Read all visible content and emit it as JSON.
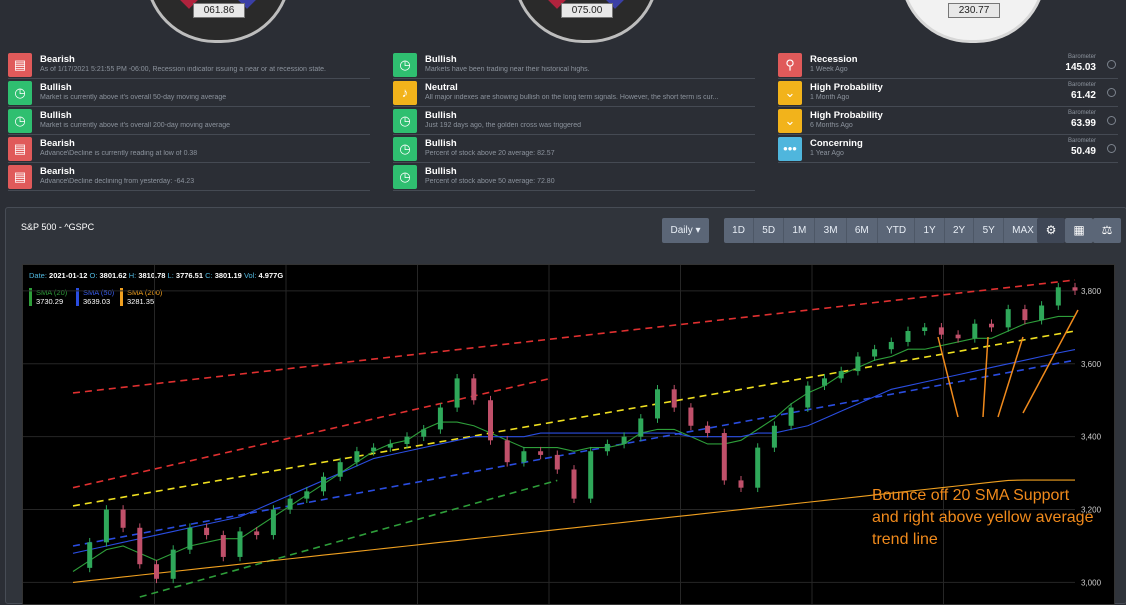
{
  "gauges": [
    {
      "value": "061.86"
    },
    {
      "value": "075.00"
    },
    {
      "value": "230.77"
    }
  ],
  "left_signals": [
    {
      "title": "Bearish",
      "sub": "As of 1/17/2021 5:21:55 PM -06:00, Recession indicator issuing a near or at recession state.",
      "color": "#e05a5a",
      "icon": "message-icon",
      "glyph": "▤"
    },
    {
      "title": "Bullish",
      "sub": "Market is currently above it's overall 50-day moving average",
      "color": "#2fbf70",
      "icon": "gauge-icon",
      "glyph": "◷"
    },
    {
      "title": "Bullish",
      "sub": "Market is currently above it's overall 200-day moving average",
      "color": "#2fbf70",
      "icon": "gauge-icon",
      "glyph": "◷"
    },
    {
      "title": "Bearish",
      "sub": "Advance\\Decline is currently reading at low of 0.38",
      "color": "#e05a5a",
      "icon": "message-icon",
      "glyph": "▤"
    },
    {
      "title": "Bearish",
      "sub": "Advance\\Decline declining from yesterday: -64.23",
      "color": "#e05a5a",
      "icon": "message-icon",
      "glyph": "▤"
    }
  ],
  "mid_signals": [
    {
      "title": "Bullish",
      "sub": "Markets have been trading near their historical highs.",
      "color": "#2fbf70",
      "icon": "gauge-icon",
      "glyph": "◷"
    },
    {
      "title": "Neutral",
      "sub": "All major indexes are showing bullish on the long term signals. However, the short term is cur...",
      "color": "#f2b31b",
      "icon": "bell-icon",
      "glyph": "♪"
    },
    {
      "title": "Bullish",
      "sub": "Just 192 days ago, the golden cross was triggered",
      "color": "#2fbf70",
      "icon": "gauge-icon",
      "glyph": "◷"
    },
    {
      "title": "Bullish",
      "sub": "Percent of stock above 20 average: 82.57",
      "color": "#2fbf70",
      "icon": "gauge-icon",
      "glyph": "◷"
    },
    {
      "title": "Bullish",
      "sub": "Percent of stock above 50 average: 72.80",
      "color": "#2fbf70",
      "icon": "gauge-icon",
      "glyph": "◷"
    }
  ],
  "right_signals": [
    {
      "title": "Recession",
      "sub": "1 Week Ago",
      "label": "Barometer",
      "value": "145.03",
      "color": "#e05a5a",
      "icon": "pin-icon",
      "glyph": "⚲"
    },
    {
      "title": "High Probability",
      "sub": "1 Month Ago",
      "label": "Barometer",
      "value": "61.42",
      "color": "#f2b31b",
      "icon": "chevron-down-icon",
      "glyph": "⌄"
    },
    {
      "title": "High Probability",
      "sub": "6 Months Ago",
      "label": "Barometer",
      "value": "63.99",
      "color": "#f2b31b",
      "icon": "chevron-down-icon",
      "glyph": "⌄"
    },
    {
      "title": "Concerning",
      "sub": "1 Year Ago",
      "label": "Barometer",
      "value": "50.49",
      "color": "#4fb6dd",
      "icon": "ellipsis-icon",
      "glyph": "•••"
    }
  ],
  "chart_card": {
    "title": "S&P 500 - ^GSPC",
    "interval": "Daily ▾",
    "periods": [
      "1D",
      "5D",
      "1M",
      "3M",
      "6M",
      "YTD",
      "1Y",
      "2Y",
      "5Y",
      "MAX"
    ]
  },
  "ohlc": {
    "date_label": "Date:",
    "date": "2021-01-12",
    "o_label": "O:",
    "o": "3801.62",
    "h_label": "H:",
    "h": "3810.78",
    "l_label": "L:",
    "l": "3776.51",
    "c_label": "C:",
    "c": "3801.19",
    "vol_label": "Vol:",
    "vol": "4.977G"
  },
  "legend": [
    {
      "name": "SMA (20)",
      "value": "3730.29",
      "color": "#2e9e3a"
    },
    {
      "name": "SMA (50)",
      "value": "3639.03",
      "color": "#2a4de0"
    },
    {
      "name": "SMA (200)",
      "value": "3281.35",
      "color": "#f0a020"
    }
  ],
  "annotation": [
    "Bounce off 20 SMA Support",
    "and right above yellow average",
    "trend line"
  ],
  "chart_data": {
    "type": "line",
    "title": "S&P 500 - ^GSPC",
    "ylim": [
      2960,
      3830
    ],
    "yticks": [
      3000,
      3200,
      3400,
      3600,
      3800
    ],
    "ytick_labels": [
      "3,000",
      "3,200",
      "3,400",
      "3,600",
      "3,800"
    ],
    "grid": true,
    "x": [
      0,
      5,
      10,
      15,
      20,
      25,
      30,
      35,
      40,
      45,
      50,
      55,
      60,
      65,
      70,
      75,
      80,
      85,
      90,
      95,
      100,
      105,
      110,
      115,
      120,
      125,
      130,
      135,
      140,
      145,
      150,
      155,
      160,
      165,
      170,
      175,
      180,
      185,
      190,
      195,
      200,
      205,
      210,
      215,
      220,
      225,
      230,
      235,
      240,
      245,
      250,
      255,
      260,
      265,
      270,
      275,
      280,
      285,
      290,
      295,
      300
    ],
    "close": [
      3040,
      3110,
      3200,
      3150,
      3050,
      3010,
      3090,
      3150,
      3130,
      3070,
      3140,
      3130,
      3200,
      3230,
      3250,
      3290,
      3330,
      3360,
      3370,
      3380,
      3400,
      3420,
      3480,
      3560,
      3500,
      3390,
      3330,
      3360,
      3350,
      3310,
      3230,
      3360,
      3380,
      3400,
      3450,
      3530,
      3480,
      3430,
      3410,
      3280,
      3260,
      3370,
      3430,
      3480,
      3540,
      3560,
      3580,
      3620,
      3640,
      3660,
      3690,
      3700,
      3680,
      3670,
      3710,
      3700,
      3750,
      3720,
      3760,
      3810,
      3801
    ],
    "series": [
      {
        "name": "SMA (20)",
        "values": [
          3030,
          3060,
          3090,
          3100,
          3080,
          3060,
          3080,
          3100,
          3110,
          3120,
          3120,
          3150,
          3180,
          3210,
          3240,
          3270,
          3300,
          3330,
          3360,
          3380,
          3390,
          3420,
          3440,
          3440,
          3430,
          3410,
          3390,
          3370,
          3370,
          3370,
          3360,
          3370,
          3370,
          3380,
          3410,
          3420,
          3420,
          3400,
          3380,
          3380,
          3390,
          3420,
          3450,
          3490,
          3520,
          3540,
          3570,
          3590,
          3610,
          3620,
          3640,
          3640,
          3650,
          3660,
          3670,
          3670,
          3690,
          3710,
          3720,
          3730,
          3730
        ]
      },
      {
        "name": "SMA (50)",
        "values": [
          3080,
          3090,
          3100,
          3110,
          3120,
          3130,
          3140,
          3150,
          3160,
          3170,
          3180,
          3200,
          3220,
          3240,
          3260,
          3280,
          3300,
          3320,
          3340,
          3350,
          3360,
          3370,
          3380,
          3390,
          3400,
          3400,
          3400,
          3400,
          3410,
          3410,
          3410,
          3410,
          3410,
          3410,
          3410,
          3410,
          3410,
          3400,
          3400,
          3400,
          3400,
          3410,
          3410,
          3420,
          3430,
          3450,
          3470,
          3490,
          3510,
          3530,
          3540,
          3550,
          3560,
          3570,
          3580,
          3590,
          3600,
          3610,
          3620,
          3630,
          3639
        ]
      },
      {
        "name": "SMA (200)",
        "values": [
          3000,
          3005,
          3010,
          3015,
          3020,
          3025,
          3030,
          3035,
          3040,
          3045,
          3050,
          3055,
          3060,
          3065,
          3070,
          3075,
          3080,
          3085,
          3090,
          3095,
          3100,
          3105,
          3110,
          3115,
          3120,
          3125,
          3130,
          3135,
          3140,
          3145,
          3150,
          3155,
          3160,
          3165,
          3170,
          3175,
          3180,
          3185,
          3190,
          3195,
          3200,
          3205,
          3210,
          3215,
          3220,
          3225,
          3230,
          3235,
          3240,
          3245,
          3250,
          3255,
          3260,
          3265,
          3270,
          3275,
          3280,
          3281,
          3281,
          3281,
          3281
        ]
      }
    ],
    "trendlines": [
      {
        "name": "red-upper",
        "color": "#e03030",
        "from": [
          0,
          3520
        ],
        "to": [
          300,
          3830
        ]
      },
      {
        "name": "red-lower",
        "color": "#e03030",
        "from": [
          0,
          3260
        ],
        "to": [
          143,
          3560
        ]
      },
      {
        "name": "yellow-average",
        "color": "#f0e020",
        "from": [
          0,
          3210
        ],
        "to": [
          300,
          3690
        ]
      },
      {
        "name": "blue",
        "color": "#2a4de0",
        "from": [
          0,
          3100
        ],
        "to": [
          300,
          3610
        ]
      },
      {
        "name": "green",
        "color": "#2e9e3a",
        "from": [
          20,
          2960
        ],
        "to": [
          145,
          3280
        ]
      }
    ]
  }
}
